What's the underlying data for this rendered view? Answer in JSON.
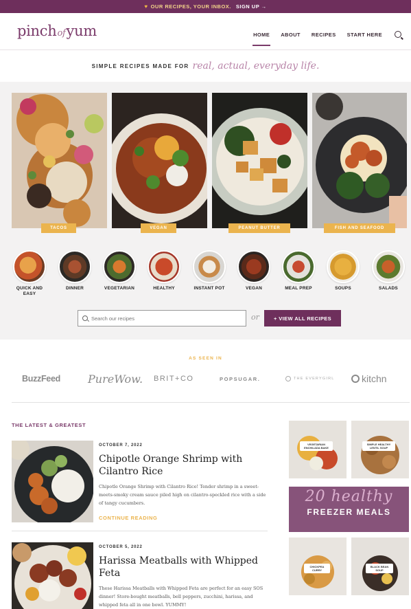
{
  "banner": {
    "text": "OUR RECIPES, YOUR INBOX.",
    "cta": "SIGN UP",
    "cta_arrow": "→",
    "heart": "♥"
  },
  "header": {
    "logo_left": "pinch",
    "logo_mid": "of",
    "logo_right": "yum",
    "nav": [
      "HOME",
      "ABOUT",
      "RECIPES",
      "START HERE"
    ]
  },
  "tagline": {
    "plain": "SIMPLE RECIPES MADE FOR",
    "script": "real, actual, everyday life."
  },
  "categories": [
    "TACOS",
    "VEGAN",
    "PEANUT BUTTER",
    "FISH AND SEAFOOD"
  ],
  "round_categories": [
    {
      "label": "QUICK AND EASY"
    },
    {
      "label": "DINNER"
    },
    {
      "label": "VEGETARIAN"
    },
    {
      "label": "HEALTHY"
    },
    {
      "label": "INSTANT POT"
    },
    {
      "label": "VEGAN"
    },
    {
      "label": "MEAL PREP"
    },
    {
      "label": "SOUPS"
    },
    {
      "label": "SALADS"
    }
  ],
  "search": {
    "placeholder": "Search our recipes",
    "or": "or",
    "view_all": "+ VIEW ALL RECIPES"
  },
  "seen_in": {
    "title": "AS SEEN IN",
    "logos": [
      "BuzzFeed",
      "PureWow.",
      "BRIT+CO",
      "POPSUGAR.",
      "THE EVERYGIRL",
      "kitchn"
    ]
  },
  "latest": {
    "title": "THE LATEST & GREATEST",
    "posts": [
      {
        "date": "OCTOBER 7, 2022",
        "title": "Chipotle Orange Shrimp with Cilantro Rice",
        "excerpt": "Chipotle Orange Shrimp with Cilantro Rice! Tender shrimp in a sweet-meets-smoky cream sauce piled high on cilantro-speckled rice with a side of tangy cucumbers.",
        "cta": "CONTINUE READING"
      },
      {
        "date": "OCTOBER 5, 2022",
        "title": "Harissa Meatballs with Whipped Feta",
        "excerpt": "These Harissa Meatballs with Whipped Feta are perfect for an easy SOS dinner! Store-bought meatballs, bell peppers, zucchini, harissa, and whipped feta all in one bowl. YUMMY!"
      }
    ]
  },
  "promo": {
    "script": "20 healthy",
    "block": "FREEZER MEALS",
    "tags": [
      "VEGETARIAN ENCHILADA BAKE",
      "SIMPLE HEALTHY LENTIL SOUP",
      "CHICKPEA CURRY",
      "BLACK BEAN SOUP"
    ]
  },
  "colors": {
    "brand": "#6e2f5c",
    "accent": "#ebb44e",
    "background": "#f3f2f2"
  }
}
